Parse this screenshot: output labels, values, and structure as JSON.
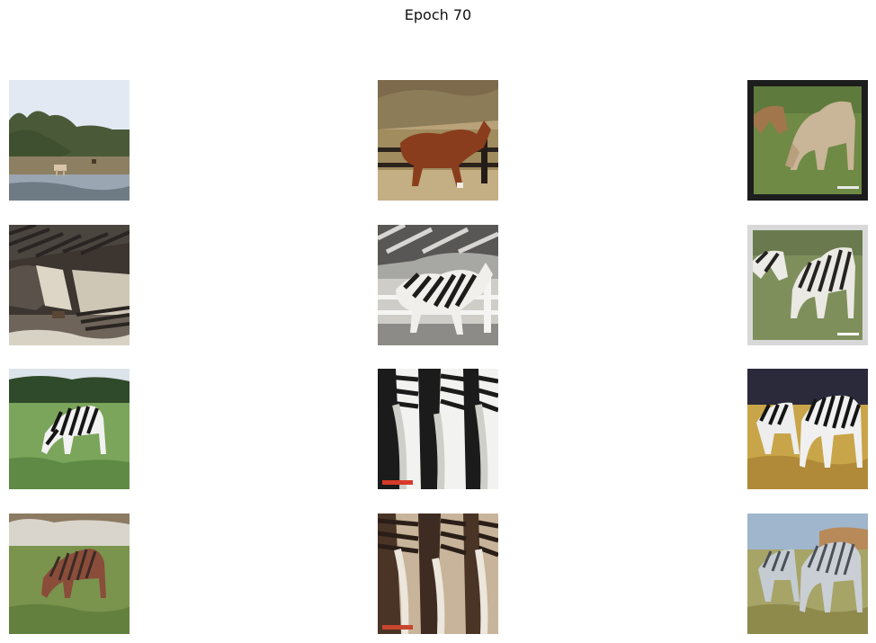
{
  "figure": {
    "title": "Epoch 70"
  },
  "grid": {
    "rows": 4,
    "cols": 3,
    "cells": [
      {
        "row": 0,
        "col": 0,
        "subject": "horses-by-water"
      },
      {
        "row": 0,
        "col": 1,
        "subject": "brown-horse-by-fence"
      },
      {
        "row": 0,
        "col": 2,
        "subject": "two-horses-grazing"
      },
      {
        "row": 1,
        "col": 0,
        "subject": "zebra-translated-horses-by-water"
      },
      {
        "row": 1,
        "col": 1,
        "subject": "zebra-translated-horse-by-fence"
      },
      {
        "row": 1,
        "col": 2,
        "subject": "zebra-translated-horses-grazing"
      },
      {
        "row": 2,
        "col": 0,
        "subject": "zebra-grazing"
      },
      {
        "row": 2,
        "col": 1,
        "subject": "zebra-rumps-closeup"
      },
      {
        "row": 2,
        "col": 2,
        "subject": "zebra-herd-dry-grass"
      },
      {
        "row": 3,
        "col": 0,
        "subject": "horse-translated-zebra-grazing"
      },
      {
        "row": 3,
        "col": 1,
        "subject": "horse-translated-zebra-rumps"
      },
      {
        "row": 3,
        "col": 2,
        "subject": "horse-translated-zebra-herd"
      }
    ]
  }
}
